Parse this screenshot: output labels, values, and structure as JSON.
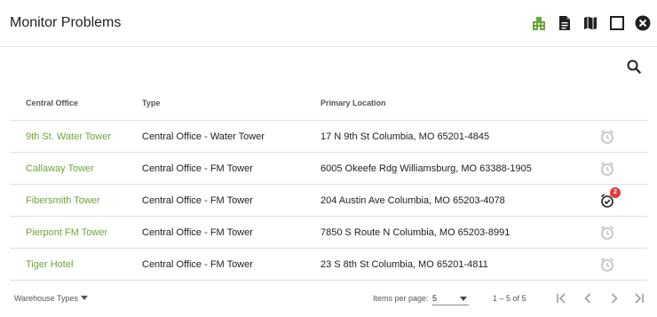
{
  "window": {
    "title": "Monitor Problems",
    "icons": [
      "building-icon",
      "document-icon",
      "map-icon",
      "maximize-icon",
      "close-icon"
    ],
    "accent_color": "#6aa63b"
  },
  "table": {
    "headers": [
      "Central Office",
      "Type",
      "Primary Location"
    ],
    "rows": [
      {
        "name": "9th St. Water Tower",
        "type": "Central Office - Water Tower",
        "location": "17 N 9th St Columbia, MO 65201-4845",
        "alarm_active": false,
        "alarm_count": ""
      },
      {
        "name": "Callaway Tower",
        "type": "Central Office - FM Tower",
        "location": "6005 Okeefe Rdg Williamsburg, MO 63388-1905",
        "alarm_active": false,
        "alarm_count": ""
      },
      {
        "name": "Fibersmith Tower",
        "type": "Central Office - FM Tower",
        "location": "204 Austin Ave Columbia, MO 65203-4078",
        "alarm_active": true,
        "alarm_count": "2"
      },
      {
        "name": "Pierpont FM Tower",
        "type": "Central Office - FM Tower",
        "location": "7850 S Route N Columbia, MO 65203-8991",
        "alarm_active": false,
        "alarm_count": ""
      },
      {
        "name": "Tiger Hotel",
        "type": "Central Office - FM Tower",
        "location": "23 S 8th St Columbia, MO 65201-4811",
        "alarm_active": false,
        "alarm_count": ""
      }
    ],
    "badge_color": "#e53935"
  },
  "footer": {
    "filter_label": "Warehouse Types",
    "items_per_page_label": "Items per page:",
    "items_per_page_value": "5",
    "range": "1 – 5 of 5"
  }
}
